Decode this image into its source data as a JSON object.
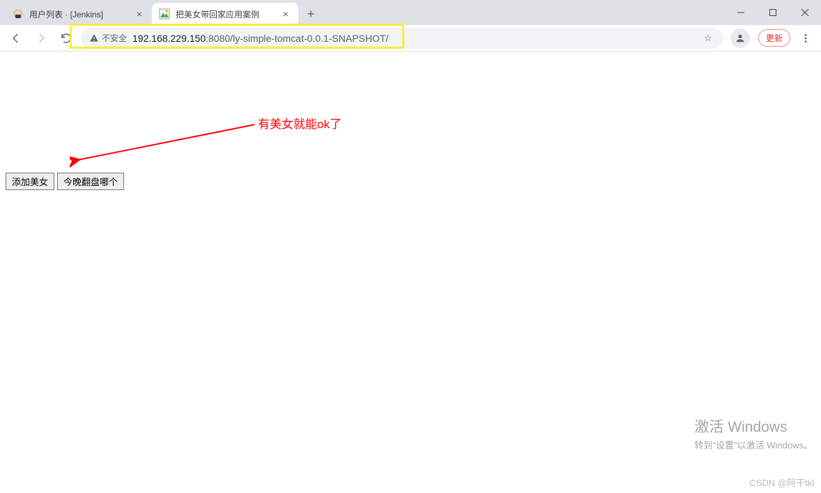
{
  "browser": {
    "tabs": [
      {
        "title": "用户列表 · [Jenkins]",
        "active": false
      },
      {
        "title": "把美女带回家应用案例",
        "active": true
      }
    ],
    "nav": {
      "insecure_label": "不安全",
      "url_host": "192.168.229.150",
      "url_port_path": ":8080/ly-simple-tomcat-0.0.1-SNAPSHOT/",
      "update_label": "更新"
    }
  },
  "page": {
    "buttons": {
      "add_label": "添加美女",
      "pick_label": "今晚翻盘哪个"
    },
    "annotation_text": "有美女就能ok了"
  },
  "watermark": {
    "line1": "激活 Windows",
    "line2": "转到\"设置\"以激活 Windows。"
  },
  "footer": {
    "csdn": "CSDN @阿干tkl"
  }
}
